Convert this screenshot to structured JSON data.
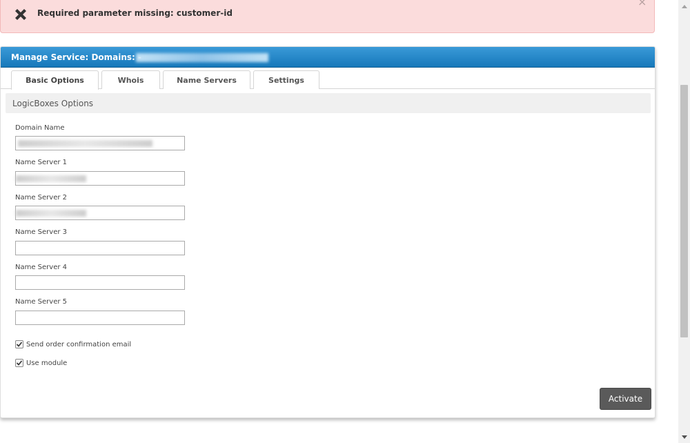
{
  "alert": {
    "icon": "close-x-icon",
    "message": "Required parameter missing: customer-id",
    "close_glyph": "×"
  },
  "panel": {
    "title": "Manage Service: Domains: -",
    "tabs": [
      {
        "label": "Basic Options",
        "active": true
      },
      {
        "label": "Whois",
        "active": false
      },
      {
        "label": "Name Servers",
        "active": false
      },
      {
        "label": "Settings",
        "active": false
      }
    ],
    "section_title": "LogicBoxes Options",
    "fields": [
      {
        "label": "Domain Name",
        "value": "",
        "redacted": true
      },
      {
        "label": "Name Server 1",
        "value": "",
        "redacted": true
      },
      {
        "label": "Name Server 2",
        "value": "",
        "redacted": true
      },
      {
        "label": "Name Server 3",
        "value": ""
      },
      {
        "label": "Name Server 4",
        "value": ""
      },
      {
        "label": "Name Server 5",
        "value": ""
      }
    ],
    "checkboxes": [
      {
        "label": "Send order confirmation email",
        "checked": true
      },
      {
        "label": "Use module",
        "checked": true
      }
    ],
    "activate_label": "Activate"
  },
  "colors": {
    "header_blue": "#1f83c6",
    "alert_bg": "#fbdcdc",
    "button_gray": "#5a5a5a"
  }
}
